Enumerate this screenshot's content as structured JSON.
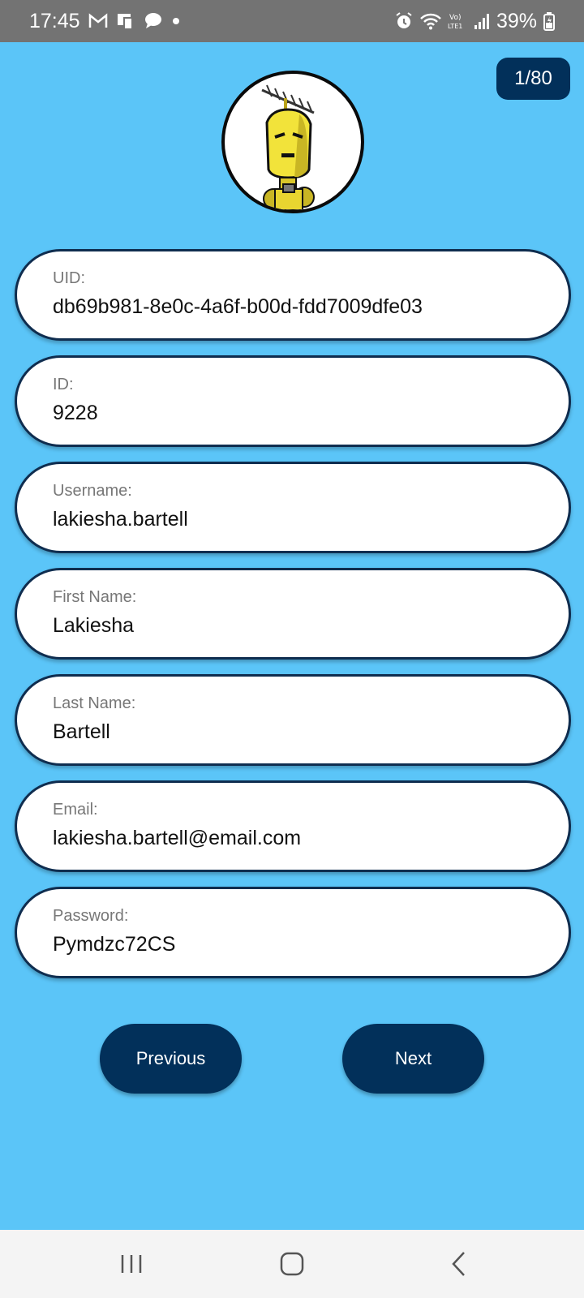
{
  "status_bar": {
    "time": "17:45",
    "battery": "39%",
    "left_icons": [
      "gmail-icon",
      "screen-icon",
      "message-icon",
      "dot-icon"
    ],
    "right_icons": [
      "alarm-icon",
      "wifi-icon",
      "volte-icon",
      "signal-icon",
      "battery-icon"
    ]
  },
  "counter": "1/80",
  "avatar": {
    "icon": "robot-avatar-icon"
  },
  "fields": [
    {
      "label": "UID:",
      "value": "db69b981-8e0c-4a6f-b00d-fdd7009dfe03"
    },
    {
      "label": "ID:",
      "value": "9228"
    },
    {
      "label": "Username:",
      "value": "lakiesha.bartell"
    },
    {
      "label": "First Name:",
      "value": "Lakiesha"
    },
    {
      "label": "Last Name:",
      "value": "Bartell"
    },
    {
      "label": "Email:",
      "value": "lakiesha.bartell@email.com"
    },
    {
      "label": "Password:",
      "value": "Pymdzc72CS"
    }
  ],
  "buttons": {
    "previous": "Previous",
    "next": "Next"
  },
  "nav_bar": {
    "icons": [
      "recent-apps-icon",
      "home-icon",
      "back-icon"
    ]
  },
  "colors": {
    "background": "#5BC5F8",
    "primary": "#02305A",
    "field_bg": "#FFFFFF",
    "status_bar": "#737373",
    "nav_bar": "#F4F4F4"
  }
}
